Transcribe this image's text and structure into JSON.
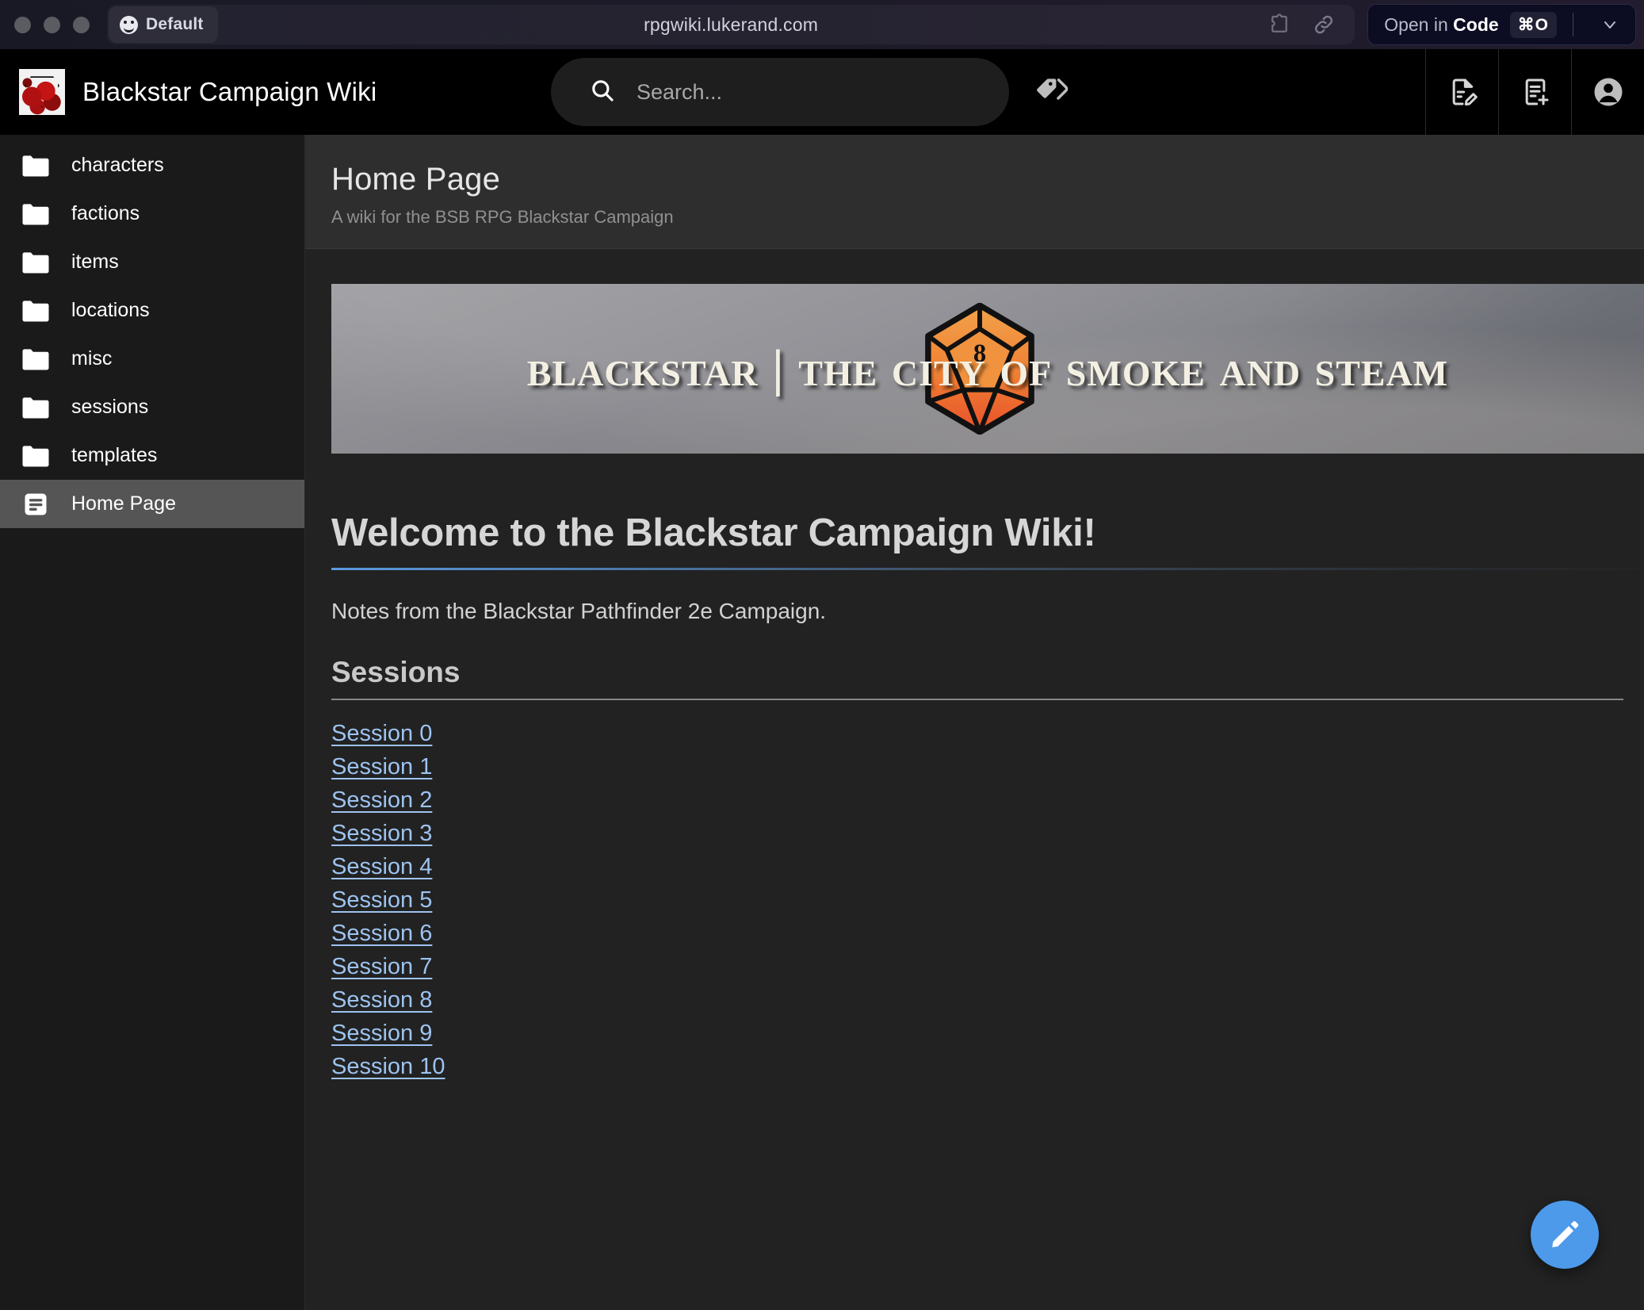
{
  "browser": {
    "profile_label": "Default",
    "url": "rpgwiki.lukerand.com",
    "extensions_icon": "puzzle-piece-icon",
    "copy_link_icon": "link-icon",
    "open_button": {
      "prefix": "Open in ",
      "app": "Code",
      "shortcut": "⌘O"
    }
  },
  "app_header": {
    "logo_icon": "blackstar-dice-logo",
    "title": "Blackstar Campaign Wiki",
    "search": {
      "placeholder": "Search...",
      "value": "",
      "icon": "search-icon"
    },
    "tags_icon": "tag-icon",
    "actions": [
      {
        "name": "edit-page-icon",
        "label": "Edit page"
      },
      {
        "name": "new-page-icon",
        "label": "New page"
      },
      {
        "name": "account-icon",
        "label": "Account"
      }
    ]
  },
  "sidebar": {
    "items": [
      {
        "label": "characters",
        "icon": "folder-icon",
        "active": false
      },
      {
        "label": "factions",
        "icon": "folder-icon",
        "active": false
      },
      {
        "label": "items",
        "icon": "folder-icon",
        "active": false
      },
      {
        "label": "locations",
        "icon": "folder-icon",
        "active": false
      },
      {
        "label": "misc",
        "icon": "folder-icon",
        "active": false
      },
      {
        "label": "sessions",
        "icon": "folder-icon",
        "active": false
      },
      {
        "label": "templates",
        "icon": "folder-icon",
        "active": false
      },
      {
        "label": "Home Page",
        "icon": "article-icon",
        "active": true
      }
    ]
  },
  "page": {
    "title": "Home Page",
    "subtitle": "A wiki for the BSB RPG Blackstar Campaign",
    "banner": {
      "text_part_1": "Blackstar",
      "divider": "|",
      "text_part_2": "The City of Smoke and Steam",
      "full_text": "Blackstar | The City of Smoke and Steam",
      "die_value": "8"
    },
    "heading": "Welcome to the Blackstar Campaign Wiki!",
    "intro": "Notes from the Blackstar Pathfinder 2e Campaign.",
    "sessions_heading": "Sessions",
    "session_links": [
      "Session 0",
      "Session 1",
      "Session 2",
      "Session 3",
      "Session 4",
      "Session 5",
      "Session 6",
      "Session 7",
      "Session 8",
      "Session 9",
      "Session 10"
    ],
    "fab": {
      "icon": "pencil-icon",
      "label": "Edit"
    }
  },
  "colors": {
    "accent_link": "#9dc3f0",
    "fab": "#4d9aea",
    "sidebar_active": "#555555",
    "content_bg": "#222222",
    "header_bg": "#2e2e2e"
  }
}
